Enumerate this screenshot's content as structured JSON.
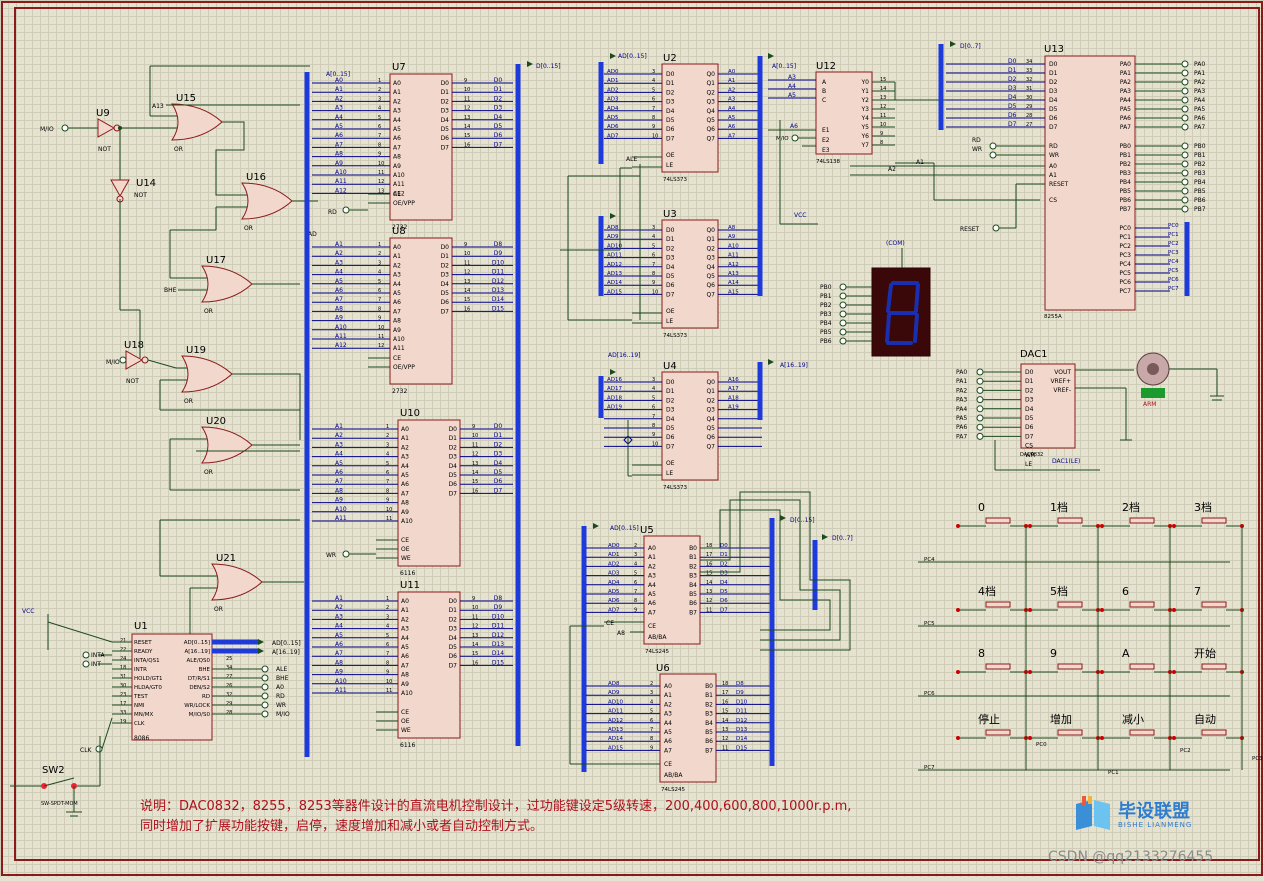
{
  "colors": {
    "wire": "#1c4a1c",
    "chip": "#f2d8cc",
    "chip_border": "#8b1a1a",
    "bus": "#1f3adb",
    "label": "#00008b",
    "title": "#b0101c",
    "pin": "#8b1a1a",
    "frame": "#8b1a1a"
  },
  "gates": [
    {
      "id": "U15",
      "type": "OR",
      "label": "OR"
    },
    {
      "id": "U16",
      "type": "OR",
      "label": "OR"
    },
    {
      "id": "U17",
      "type": "OR",
      "label": "OR"
    },
    {
      "id": "U19",
      "type": "OR",
      "label": "OR"
    },
    {
      "id": "U20",
      "type": "OR",
      "label": "OR"
    },
    {
      "id": "U21",
      "type": "OR",
      "label": "OR"
    },
    {
      "id": "U9",
      "type": "NOT",
      "label": "NOT"
    },
    {
      "id": "U14",
      "type": "NOT",
      "label": "NOT"
    },
    {
      "id": "U18",
      "type": "NOT",
      "label": "NOT"
    }
  ],
  "net_labels": {
    "mio1": "M/IO",
    "mio2": "M/IO",
    "bhe": "BHE",
    "a13": "A13",
    "rd": "RD",
    "wr": "WR",
    "ad": "AD",
    "clk": "CLK",
    "ad_015": "AD[0..15]",
    "d_015": "D[0..15]",
    "d_07": "D[0..7]",
    "a_015": "A[0..15]",
    "a_1619": "A[16..19]",
    "ad_1619": "AD[16..19]",
    "vcc1": "VCC",
    "vcc2": "VCC",
    "reset": "RESET",
    "a1": "A1",
    "a2": "A2",
    "com": "(COM)",
    "arm": "ARM"
  },
  "u1": {
    "id": "U1",
    "part": "8086",
    "left_pins": [
      [
        "21",
        "RESET"
      ],
      [
        "22",
        "READY"
      ],
      [
        "24",
        "INTA/QS1"
      ],
      [
        "18",
        "INTR"
      ],
      [
        "31",
        "HOLD/GT1"
      ],
      [
        "30",
        "HLDA/GT0"
      ],
      [
        "23",
        "TEST"
      ],
      [
        "17",
        "NMI"
      ],
      [
        "33",
        "MN/MX"
      ],
      [
        "19",
        "CLK"
      ]
    ],
    "right_pins": [
      [
        "",
        "AD[0..15]"
      ],
      [
        "",
        "A[16..19]"
      ],
      [
        "25",
        "ALE/QS0"
      ],
      [
        "34",
        "BHE"
      ],
      [
        "27",
        "DT/R/S1"
      ],
      [
        "26",
        "DEN/S2"
      ],
      [
        "32",
        "RD"
      ],
      [
        "29",
        "WR/LOCK"
      ],
      [
        "28",
        "M/IO/S0"
      ]
    ],
    "outs": [
      "ALE",
      "BHE",
      "A0",
      "RD",
      "WR",
      "M/IO"
    ],
    "ins": [
      "INTA",
      "INT"
    ]
  },
  "rom_ram": [
    {
      "id": "U7",
      "part": "2732"
    },
    {
      "id": "U8",
      "part": "2732"
    },
    {
      "id": "U10",
      "part": "6116"
    },
    {
      "id": "U11",
      "part": "6116"
    }
  ],
  "mem": {
    "u7_in": [
      "A0",
      "A1",
      "A2",
      "A3",
      "A4",
      "A5",
      "A6",
      "A7",
      "A8",
      "A9",
      "A10",
      "A11",
      "A12"
    ],
    "u7_out": [
      "D0",
      "D1",
      "D2",
      "D3",
      "D4",
      "D5",
      "D6",
      "D7"
    ],
    "u8_in": [
      "A1",
      "A2",
      "A3",
      "A4",
      "A5",
      "A6",
      "A7",
      "A8",
      "A9",
      "A10",
      "A11",
      "A12"
    ],
    "u8_out": [
      "D8",
      "D9",
      "D10",
      "D11",
      "D12",
      "D13",
      "D14",
      "D15"
    ],
    "u10_in": [
      "A1",
      "A2",
      "A3",
      "A4",
      "A5",
      "A6",
      "A7",
      "A8",
      "A9",
      "A10",
      "A11"
    ],
    "u10_out": [
      "D0",
      "D1",
      "D2",
      "D3",
      "D4",
      "D5",
      "D6",
      "D7"
    ],
    "u11_in": [
      "A1",
      "A2",
      "A3",
      "A4",
      "A5",
      "A6",
      "A7",
      "A8",
      "A9",
      "A10",
      "A11"
    ],
    "u11_out": [
      "D8",
      "D9",
      "D10",
      "D11",
      "D12",
      "D13",
      "D14",
      "D15"
    ],
    "addr_pins": [
      "A0",
      "A1",
      "A2",
      "A3",
      "A4",
      "A5",
      "A6",
      "A7",
      "A8",
      "A9",
      "A10",
      "A11"
    ],
    "data_pins": [
      "D0",
      "D1",
      "D2",
      "D3",
      "D4",
      "D5",
      "D6",
      "D7"
    ],
    "rom_ctrl": [
      "CE",
      "OE/VPP"
    ],
    "ram_ctrl": [
      "CE",
      "OE",
      "WE"
    ]
  },
  "latches": [
    {
      "id": "U2",
      "part": "74LS373",
      "in": [
        "AD0",
        "AD1",
        "AD2",
        "AD3",
        "AD4",
        "AD5",
        "AD6",
        "AD7"
      ],
      "out": [
        "A0",
        "A1",
        "A2",
        "A3",
        "A4",
        "A5",
        "A6",
        "A7"
      ]
    },
    {
      "id": "U3",
      "part": "74LS373",
      "in": [
        "AD8",
        "AD9",
        "AD10",
        "AD11",
        "AD12",
        "AD13",
        "AD14",
        "AD15"
      ],
      "out": [
        "A8",
        "A9",
        "A10",
        "A11",
        "A12",
        "A13",
        "A14",
        "A15"
      ]
    },
    {
      "id": "U4",
      "part": "74LS373",
      "in": [
        "AD16",
        "AD17",
        "AD18",
        "AD19",
        "",
        "",
        "",
        ""
      ],
      "out": [
        "A16",
        "A17",
        "A18",
        "A19",
        "",
        "",
        "",
        ""
      ]
    }
  ],
  "latch_pins": {
    "in": [
      "D0",
      "D1",
      "D2",
      "D3",
      "D4",
      "D5",
      "D6",
      "D7"
    ],
    "out": [
      "Q0",
      "Q1",
      "Q2",
      "Q3",
      "Q4",
      "Q5",
      "Q6",
      "Q7"
    ],
    "ctrl": [
      "OE",
      "LE"
    ]
  },
  "buffers": [
    {
      "id": "U5",
      "part": "74LS245",
      "in": [
        "AD0",
        "AD1",
        "AD2",
        "AD3",
        "AD4",
        "AD5",
        "AD6",
        "AD7"
      ],
      "out": [
        "D0",
        "D1",
        "D2",
        "D3",
        "D4",
        "D5",
        "D6",
        "D7"
      ]
    },
    {
      "id": "U6",
      "part": "74LS245",
      "in": [
        "AD8",
        "AD9",
        "AD10",
        "AD11",
        "AD12",
        "AD13",
        "AD14",
        "AD15"
      ],
      "out": [
        "D8",
        "D9",
        "D10",
        "D11",
        "D12",
        "D13",
        "D14",
        "D15"
      ]
    }
  ],
  "buffer_pins": {
    "in": [
      "A0",
      "A1",
      "A2",
      "A3",
      "A4",
      "A5",
      "A6",
      "A7"
    ],
    "out": [
      "B0",
      "B1",
      "B2",
      "B3",
      "B4",
      "B5",
      "B6",
      "B7"
    ],
    "ctrl": [
      "CE",
      "AB/BA"
    ]
  },
  "u12": {
    "id": "U12",
    "part": "74LS138",
    "in": [
      "A",
      "B",
      "C",
      "E1",
      "E2",
      "E3"
    ],
    "out": [
      "Y0",
      "Y1",
      "Y2",
      "Y3",
      "Y4",
      "Y5",
      "Y6",
      "Y7"
    ],
    "nets": [
      "A3",
      "A4",
      "A5",
      "A6",
      "M/IO"
    ]
  },
  "u13": {
    "id": "U13",
    "part": "8255A",
    "left": [
      "D0",
      "D1",
      "D2",
      "D3",
      "D4",
      "D5",
      "D6",
      "D7",
      "RD",
      "WR",
      "A0",
      "A1",
      "RESET",
      "CS"
    ],
    "pa": [
      "PA0",
      "PA1",
      "PA2",
      "PA3",
      "PA4",
      "PA5",
      "PA6",
      "PA7"
    ],
    "pb": [
      "PB0",
      "PB1",
      "PB2",
      "PB3",
      "PB4",
      "PB5",
      "PB6",
      "PB7"
    ],
    "pc": [
      "PC0",
      "PC1",
      "PC2",
      "PC3",
      "PC4",
      "PC5",
      "PC6",
      "PC7"
    ]
  },
  "dac": {
    "id": "DAC1",
    "part": "DAC0832",
    "in": [
      "D0",
      "D1",
      "D2",
      "D3",
      "D4",
      "D5",
      "D6",
      "D7",
      "CS",
      "WR",
      "LE"
    ],
    "right": [
      "VOUT",
      "VREF+",
      "VREF-"
    ],
    "tag": "DAC1(LE)",
    "inputs": [
      "PA0",
      "PA1",
      "PA2",
      "PA3",
      "PA4",
      "PA5",
      "PA6",
      "PA7"
    ]
  },
  "seg_inputs": [
    "PB0",
    "PB1",
    "PB2",
    "PB3",
    "PB4",
    "PB5",
    "PB6"
  ],
  "keys": [
    [
      "0",
      "1档",
      "2档",
      "3档"
    ],
    [
      "4档",
      "5档",
      "6",
      "7"
    ],
    [
      "8",
      "9",
      "A",
      "开始"
    ],
    [
      "停止",
      "增加",
      "减小",
      "自动"
    ]
  ],
  "key_rows": [
    "PC4",
    "PC5",
    "PC6",
    "PC7"
  ],
  "key_cols": [
    "PC0",
    "PC1",
    "PC2",
    "PC3"
  ],
  "sw2": {
    "id": "SW2",
    "part": "SW-SPDT-MOM"
  },
  "description": {
    "line1": "说明：DAC0832，8255，8253等器件设计的直流电机控制设计，过功能键设定5级转速，200,400,600,800,1000r.p.m,",
    "line2": "同时增加了扩展功能按键，启停，速度增加和减小或者自动控制方式。"
  },
  "watermark": {
    "brand": "毕设联盟",
    "sub": "BISHE LIANMENG",
    "credit": "CSDN @qq2133276455"
  }
}
